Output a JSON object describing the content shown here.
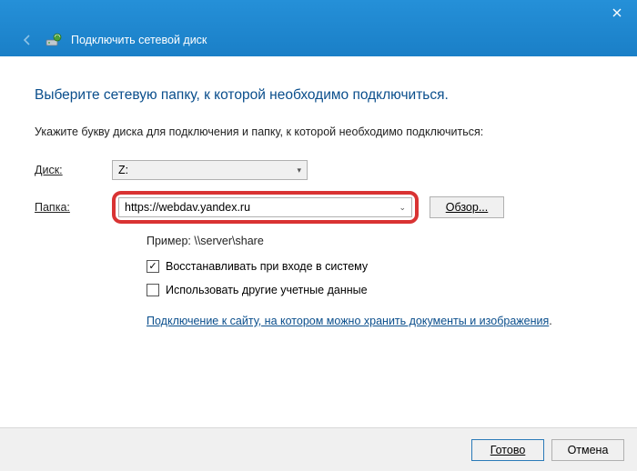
{
  "titlebar": {
    "title": "Подключить сетевой диск"
  },
  "main": {
    "heading": "Выберите сетевую папку, к которой необходимо подключиться.",
    "instruction": "Укажите букву диска для подключения и папку, к которой необходимо подключиться:",
    "drive_label": "Диск:",
    "drive_value": "Z:",
    "folder_label": "Папка:",
    "folder_value": "https://webdav.yandex.ru",
    "browse_label": "Обзор...",
    "example": "Пример: \\\\server\\share",
    "checkbox_reconnect": "Восстанавливать при входе в систему",
    "checkbox_reconnect_checked": true,
    "checkbox_credentials": "Использовать другие учетные данные",
    "checkbox_credentials_checked": false,
    "storage_link": "Подключение к сайту, на котором можно хранить документы и изображения"
  },
  "footer": {
    "primary": "Готово",
    "cancel": "Отмена"
  }
}
